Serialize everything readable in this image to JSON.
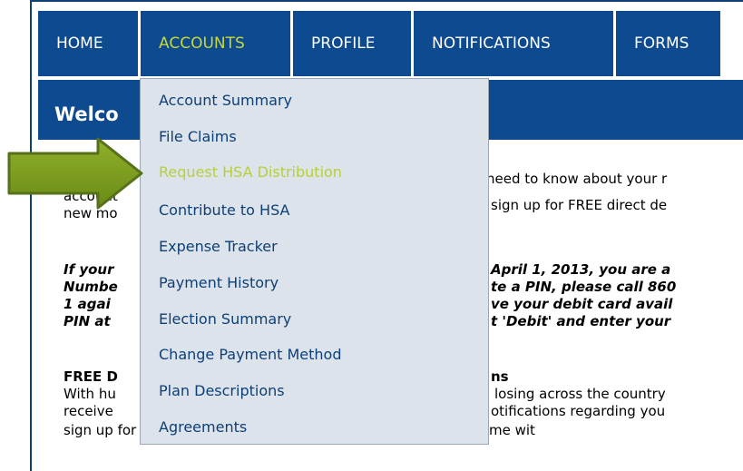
{
  "nav": {
    "tabs": [
      {
        "label": "HOME",
        "active": false
      },
      {
        "label": "ACCOUNTS",
        "active": true
      },
      {
        "label": "PROFILE",
        "active": false
      },
      {
        "label": "NOTIFICATIONS",
        "active": false
      },
      {
        "label": "FORMS",
        "active": false
      }
    ]
  },
  "welcome": {
    "title": "Welco"
  },
  "dropdown": {
    "items": [
      {
        "label": "Account Summary",
        "active": false
      },
      {
        "label": "File Claims",
        "active": false
      },
      {
        "label": "Request HSA Distribution",
        "active": true
      },
      {
        "label": "Contribute to HSA",
        "active": false
      },
      {
        "label": "Expense Tracker",
        "active": false
      },
      {
        "label": "Payment History",
        "active": false
      },
      {
        "label": "Election Summary",
        "active": false
      },
      {
        "label": "Change Payment Method",
        "active": false
      },
      {
        "label": "Plan Descriptions",
        "active": false
      },
      {
        "label": "Agreements",
        "active": false
      }
    ]
  },
  "body": {
    "p1": {
      "line1_right": "need to know about your r",
      "line2_left": "account",
      "line2_right": "sign up for FREE direct de",
      "line3_left": "new mo"
    },
    "p2": {
      "line1_left": "If your",
      "line1_right": "April 1, 2013, you are a",
      "line2_left": "Numbe",
      "line2_right": "te a PIN, please call 860",
      "line3_left": "1 agai",
      "line3_right": "ve your debit card avail",
      "line4_left": "PIN at",
      "line4_right": "t 'Debit' and enter your"
    },
    "p3": {
      "heading_left": "FREE D",
      "heading_right": "ns",
      "line1_left": "With hu",
      "line1_right": "losing across the country",
      "line2_left": "receive",
      "line2_right": "otifications regarding you",
      "line3": "sign up for FREE direct deposit and email notifications at anytime wit"
    }
  },
  "colors": {
    "nav_bg": "#0d4a8f",
    "active_text": "#c6d83a",
    "dropdown_bg": "#dde3ea",
    "dropdown_text": "#0d3f78",
    "arrow_fill": "#7a9a1e"
  },
  "icons": {
    "pointer": "green-arrow-icon"
  }
}
